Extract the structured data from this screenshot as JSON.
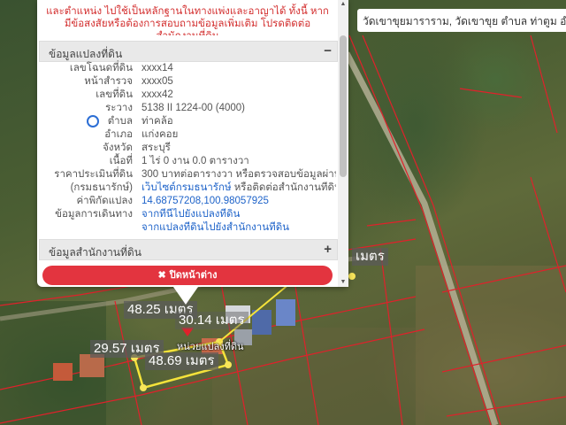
{
  "location_label": "วัดเขาขุยมาราราม, วัดเขาขุย ตำบล ท่าตูม อำเภ",
  "popup": {
    "note": "และตำแหน่ง ไปใช้เป็นหลักฐานในทางแพ่งและอาญาได้ ทั้งนี้ หากมีข้อสงสัยหรือต้องการสอบถามข้อมูลเพิ่มเติม โปรดติดต่อสำนักงานที่ดิน",
    "section_parcel": {
      "title": "ข้อมูลแปลงที่ดิน",
      "toggle": "−"
    },
    "rows": [
      {
        "key": "เลขโฉนดที่ดิน",
        "value": "xxxx14"
      },
      {
        "key": "หน้าสำรวจ",
        "value": "xxxx05"
      },
      {
        "key": "เลขที่ดิน",
        "value": "xxxx42"
      },
      {
        "key": "ระวาง",
        "value": "5138 II 1224-00 (4000)"
      },
      {
        "key": "ตำบล",
        "value": "ท่าคล้อ"
      },
      {
        "key": "อำเภอ",
        "value": "แก่งคอย"
      },
      {
        "key": "จังหวัด",
        "value": "สระบุรี"
      },
      {
        "key": "เนื้อที่",
        "value": "1 ไร่ 0 งาน 0.0 ตารางวา"
      },
      {
        "key": "ราคาประเมินที่ดิน",
        "value": "300 บาทต่อตารางวา หรือตรวจสอบข้อมูลผ่านทาง"
      },
      {
        "key": "(กรมธนารักษ์)",
        "value_link": "เว็บไซต์กรมธนารักษ์",
        "value_suffix": " หรือติดต่อสำนักงานที่ดิน"
      },
      {
        "key": "ค่าพิกัดแปลง",
        "value": "14.68757208,100.98057925"
      },
      {
        "key": "ข้อมูลการเดินทาง",
        "value": "จากที่นี่ไปยังแปลงที่ดิน"
      },
      {
        "key": "",
        "value": "จากแปลงที่ดินไปยังสำนักงานที่ดิน"
      }
    ],
    "section_office": {
      "title": "ข้อมูลสำนักงานที่ดิน",
      "toggle": "+"
    },
    "close_button": {
      "icon": "✖",
      "label": "ปิดหน้าต่าง"
    }
  },
  "measurements": {
    "top": "48.25 เมตร",
    "top2": "30.14 เมตร",
    "left": "29.57 เมตร",
    "bottom": "48.69 เมตร",
    "right_partial": "เมตร",
    "parcel_label": "หน่วยแปลงที่ดิน"
  },
  "colors": {
    "parcel_outline": "#f5e33a",
    "boundary": "#e0212b",
    "close_button": "#e3343f",
    "link": "#1e63c9"
  }
}
